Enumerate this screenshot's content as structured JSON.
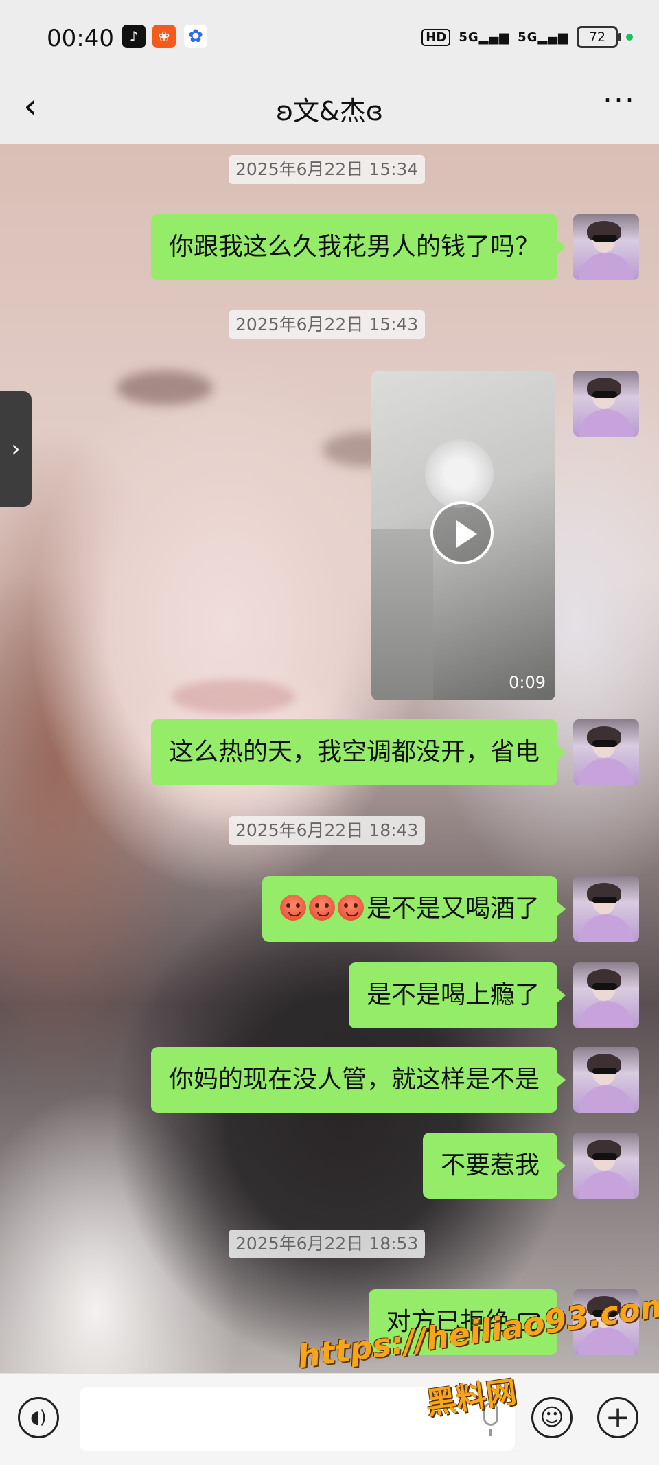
{
  "status_bar": {
    "time": "00:40",
    "app_icons": [
      "tiktok-icon",
      "kuaishou-icon",
      "baidu-icon"
    ],
    "network": "HD",
    "signal1": "5G",
    "signal2": "5G",
    "battery": "72"
  },
  "header": {
    "title": "文&杰",
    "back_icon": "chevron-left-icon",
    "more_icon": "more-dots-icon"
  },
  "messages": [
    {
      "type": "timestamp",
      "text": "2025年6月22日 15:34"
    },
    {
      "type": "text",
      "from": "me",
      "text": "你跟我这么久我花男人的钱了吗？"
    },
    {
      "type": "timestamp",
      "text": "2025年6月22日 15:43"
    },
    {
      "type": "video",
      "from": "me",
      "duration": "0:09"
    },
    {
      "type": "text",
      "from": "me",
      "text": "这么热的天，我空调都没开，省电"
    },
    {
      "type": "timestamp",
      "text": "2025年6月22日 18:43"
    },
    {
      "type": "text",
      "from": "me",
      "emoji_count": 3,
      "emoji": "angry-face-icon",
      "text": "是不是又喝酒了"
    },
    {
      "type": "text",
      "from": "me",
      "text": "是不是喝上瘾了"
    },
    {
      "type": "text",
      "from": "me",
      "text": "你妈的现在没人管，就这样是不是"
    },
    {
      "type": "text",
      "from": "me",
      "text": "不要惹我"
    },
    {
      "type": "timestamp",
      "text": "2025年6月22日 18:53"
    },
    {
      "type": "call",
      "from": "me",
      "text": "对方已拒绝",
      "icon": "call-icon"
    }
  ],
  "input_bar": {
    "voice_icon": "voice-icon",
    "mic_icon": "microphone-icon",
    "emoji_icon": "emoji-icon",
    "plus_icon": "plus-icon"
  },
  "watermark": {
    "url": "https://heiliao93.com",
    "name": "黑料网"
  },
  "colors": {
    "bubble": "#95ec69",
    "bar": "#ededed",
    "watermark": "#f7a51a"
  }
}
